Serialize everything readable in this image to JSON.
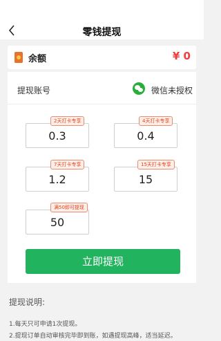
{
  "header": {
    "title": "零钱提现"
  },
  "balance": {
    "label": "余额",
    "value": "¥ 0"
  },
  "account": {
    "label": "提现账号",
    "status": "微信未授权"
  },
  "amounts": [
    {
      "value": "0.3",
      "tag": "2天打卡专享"
    },
    {
      "value": "0.4",
      "tag": "4天打卡专享"
    },
    {
      "value": "1.2",
      "tag": "7天打卡专享"
    },
    {
      "value": "15",
      "tag": "15天打卡专享"
    },
    {
      "value": "50",
      "tag": "满50即可提现"
    }
  ],
  "button": {
    "label": "立即提现"
  },
  "notes": {
    "title": "提现说明:",
    "lines": [
      "1.每天只可申请1次提现。",
      "2.提现订单自动审核完毕即到账，如遇提现高峰，适当延迟。"
    ]
  },
  "colors": {
    "accent": "#22b35f",
    "price": "#f53b3b",
    "tag": "#e0441f"
  }
}
